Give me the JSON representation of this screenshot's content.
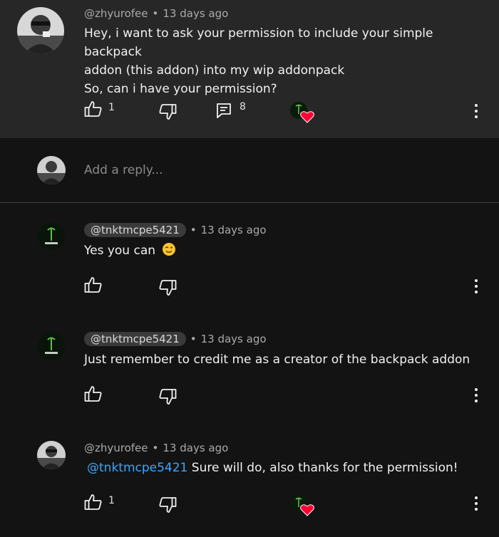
{
  "comment": {
    "author": "@zhyurofee",
    "time": "13 days ago",
    "lines": [
      "Hey, i want to ask your permission to include your simple backpack",
      "addon (this addon) into my wip addonpack",
      "So, can i have your permission?"
    ],
    "likes": "1",
    "replies": "8"
  },
  "reply_box": {
    "placeholder": "Add a reply..."
  },
  "replies": [
    {
      "author": "@tnktmcpe5421",
      "time": "13 days ago",
      "text": "Yes you can",
      "emoji": "winking-face"
    },
    {
      "author": "@tnktmcpe5421",
      "time": "13 days ago",
      "text": "Just remember to credit me as a creator of the backpack addon"
    },
    {
      "author": "@zhyurofee",
      "time": "13 days ago",
      "mention": "@tnktmcpe5421",
      "text": "Sure will do, also thanks for the permission!",
      "likes": "1"
    }
  ],
  "colors": {
    "mention": "#3ea6ff",
    "heart": "#ff0033",
    "surface": "#272727",
    "background": "#131313"
  }
}
